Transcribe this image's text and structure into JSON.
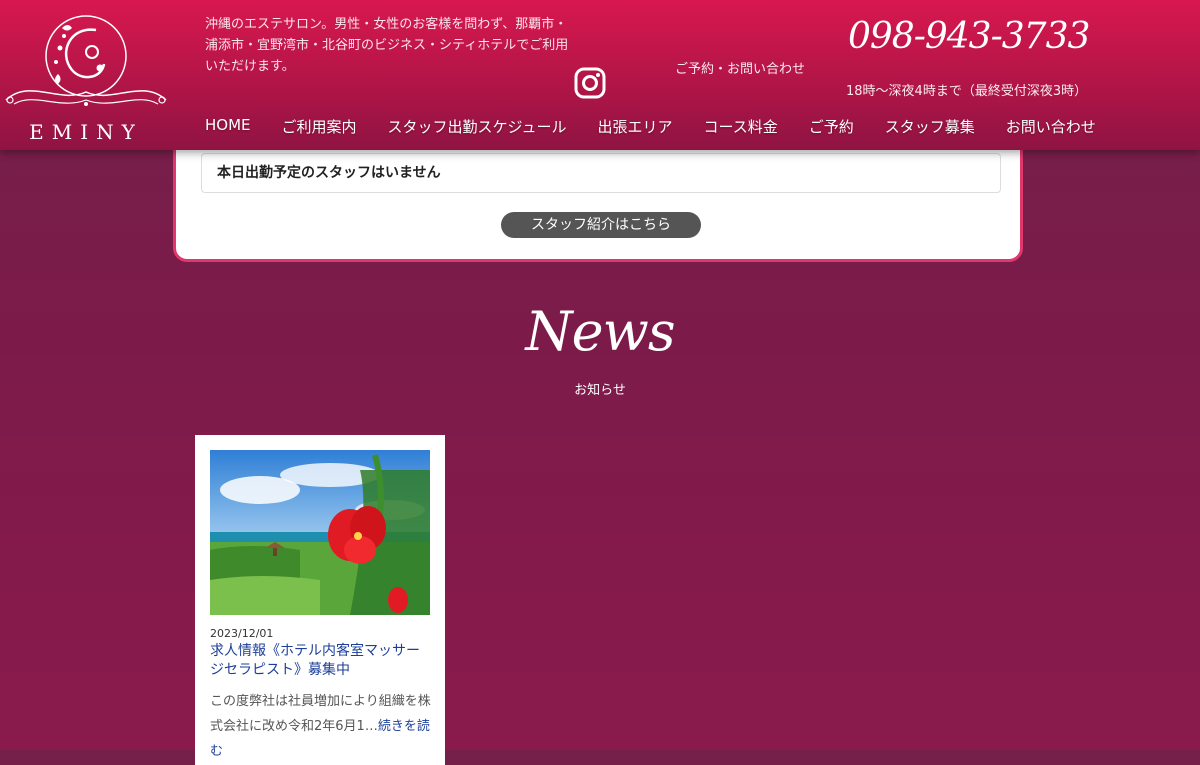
{
  "header": {
    "logo_text": "EMINY",
    "tagline": "沖縄のエステサロン。男性・女性のお客様を問わず、那覇市・浦添市・宜野湾市・北谷町のビジネス・シティホテルでご利用いただけます。",
    "contact_label": "ご予約・お問い合わせ",
    "phone": "098-943-3733",
    "hours": "18時〜深夜4時まで（最終受付深夜3時）",
    "instagram_icon": "instagram-icon"
  },
  "nav": {
    "items": [
      "HOME",
      "ご利用案内",
      "スタッフ出勤スケジュール",
      "出張エリア",
      "コース料金",
      "ご予約",
      "スタッフ募集",
      "お問い合わせ"
    ]
  },
  "staff_panel": {
    "message": "本日出勤予定のスタッフはいません",
    "button_label": "スタッフ紹介はこちら"
  },
  "news": {
    "title": "News",
    "subtitle": "お知らせ",
    "posts": [
      {
        "date": "2023/12/01",
        "title": "求人情報《ホテル内客室マッサージセラピスト》募集中",
        "excerpt": "この度弊社は社員増加により組織を株式会社に改め令和2年6月1…",
        "more": "続きを読む"
      }
    ]
  },
  "colors": {
    "header_top": "#d8184f",
    "panel_border": "#e0386d",
    "background": "#7c1b4a",
    "link": "#1d3f9a"
  }
}
